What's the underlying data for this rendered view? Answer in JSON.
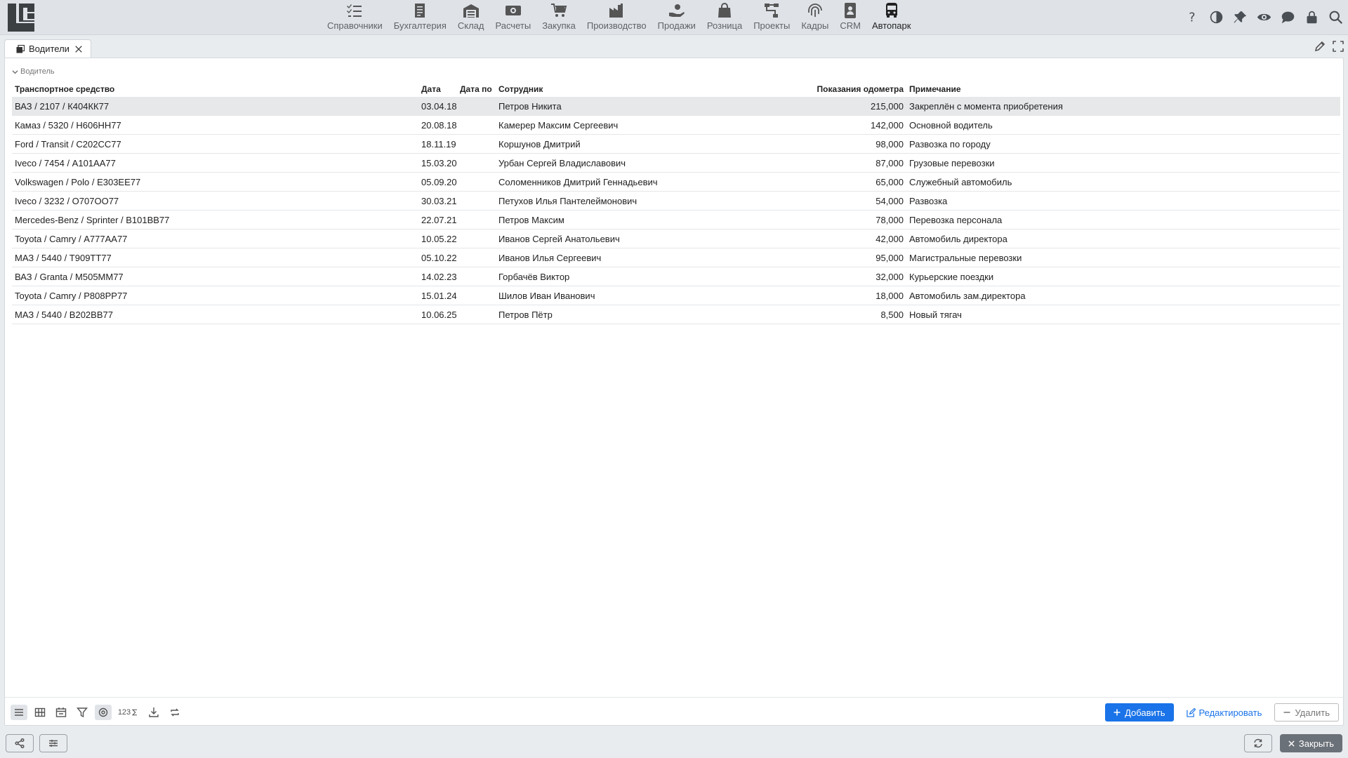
{
  "modules": [
    {
      "label": "Справочники",
      "icon": "list-check-icon"
    },
    {
      "label": "Бухгалтерия",
      "icon": "ledger-icon"
    },
    {
      "label": "Склад",
      "icon": "warehouse-icon"
    },
    {
      "label": "Расчеты",
      "icon": "money-icon"
    },
    {
      "label": "Закупка",
      "icon": "cart-icon"
    },
    {
      "label": "Производство",
      "icon": "factory-icon"
    },
    {
      "label": "Продажи",
      "icon": "hand-coin-icon"
    },
    {
      "label": "Розница",
      "icon": "shopping-bag-icon"
    },
    {
      "label": "Проекты",
      "icon": "project-tree-icon"
    },
    {
      "label": "Кадры",
      "icon": "fingerprint-icon"
    },
    {
      "label": "CRM",
      "icon": "contact-card-icon"
    },
    {
      "label": "Автопарк",
      "icon": "bus-icon"
    }
  ],
  "active_module": "Автопарк",
  "top_actions": [
    "help-icon",
    "contrast-icon",
    "pin-icon",
    "eye-icon",
    "chat-icon",
    "lock-icon",
    "search-icon"
  ],
  "tab": {
    "label": "Водители"
  },
  "group": {
    "label": "Водитель"
  },
  "table": {
    "headers": {
      "vehicle": "Транспортное средство",
      "date": "Дата",
      "date_to": "Дата по",
      "employee": "Сотрудник",
      "odometer": "Показания одометра",
      "note": "Примечание"
    },
    "rows": [
      {
        "vehicle": "ВАЗ / 2107 / К404КК77",
        "date": "03.04.18",
        "date_to": "",
        "employee": "Петров Никита",
        "odometer": "215,000",
        "note": "Закреплён с момента приобретения"
      },
      {
        "vehicle": "Камаз / 5320 / Н606НН77",
        "date": "20.08.18",
        "date_to": "",
        "employee": "Камерер Максим Сергеевич",
        "odometer": "142,000",
        "note": "Основной водитель"
      },
      {
        "vehicle": "Ford / Transit / С202СС77",
        "date": "18.11.19",
        "date_to": "",
        "employee": "Коршунов Дмитрий",
        "odometer": "98,000",
        "note": "Развозка по городу"
      },
      {
        "vehicle": "Iveco / 7454 / А101АА77",
        "date": "15.03.20",
        "date_to": "",
        "employee": "Урбан Сергей Владиславович",
        "odometer": "87,000",
        "note": "Грузовые перевозки"
      },
      {
        "vehicle": "Volkswagen / Polo / Е303ЕЕ77",
        "date": "05.09.20",
        "date_to": "",
        "employee": "Соломенников Дмитрий Геннадьевич",
        "odometer": "65,000",
        "note": "Служебный автомобиль"
      },
      {
        "vehicle": "Iveco / 3232 / О707ОО77",
        "date": "30.03.21",
        "date_to": "",
        "employee": "Петухов Илья Пантелеймонович",
        "odometer": "54,000",
        "note": "Развозка"
      },
      {
        "vehicle": "Mercedes-Benz / Sprinter / В101ВВ77",
        "date": "22.07.21",
        "date_to": "",
        "employee": "Петров Максим",
        "odometer": "78,000",
        "note": "Перевозка персонала"
      },
      {
        "vehicle": "Toyota / Camry / А777АА77",
        "date": "10.05.22",
        "date_to": "",
        "employee": "Иванов Сергей Анатольевич",
        "odometer": "42,000",
        "note": "Автомобиль директора"
      },
      {
        "vehicle": "МАЗ / 5440 / Т909ТТ77",
        "date": "05.10.22",
        "date_to": "",
        "employee": "Иванов Илья Сергеевич",
        "odometer": "95,000",
        "note": "Магистральные перевозки"
      },
      {
        "vehicle": "ВАЗ / Granta / М505ММ77",
        "date": "14.02.23",
        "date_to": "",
        "employee": "Горбачёв Виктор",
        "odometer": "32,000",
        "note": "Курьерские поездки"
      },
      {
        "vehicle": "Toyota / Camry / Р808РР77",
        "date": "15.01.24",
        "date_to": "",
        "employee": "Шилов Иван Иванович",
        "odometer": "18,000",
        "note": "Автомобиль зам.директора"
      },
      {
        "vehicle": "МАЗ / 5440 / В202ВВ77",
        "date": "10.06.25",
        "date_to": "",
        "employee": "Петров Пётр",
        "odometer": "8,500",
        "note": "Новый тягач"
      }
    ],
    "selected_row": 0
  },
  "toolbar": {
    "sum_label": "123",
    "add_label": "Добавить",
    "edit_label": "Редактировать",
    "delete_label": "Удалить"
  },
  "footer": {
    "close_label": "Закрыть"
  },
  "colors": {
    "accent": "#1a73e8",
    "topbar": "#dfe3e8",
    "selected_row": "#e6e8ea"
  }
}
